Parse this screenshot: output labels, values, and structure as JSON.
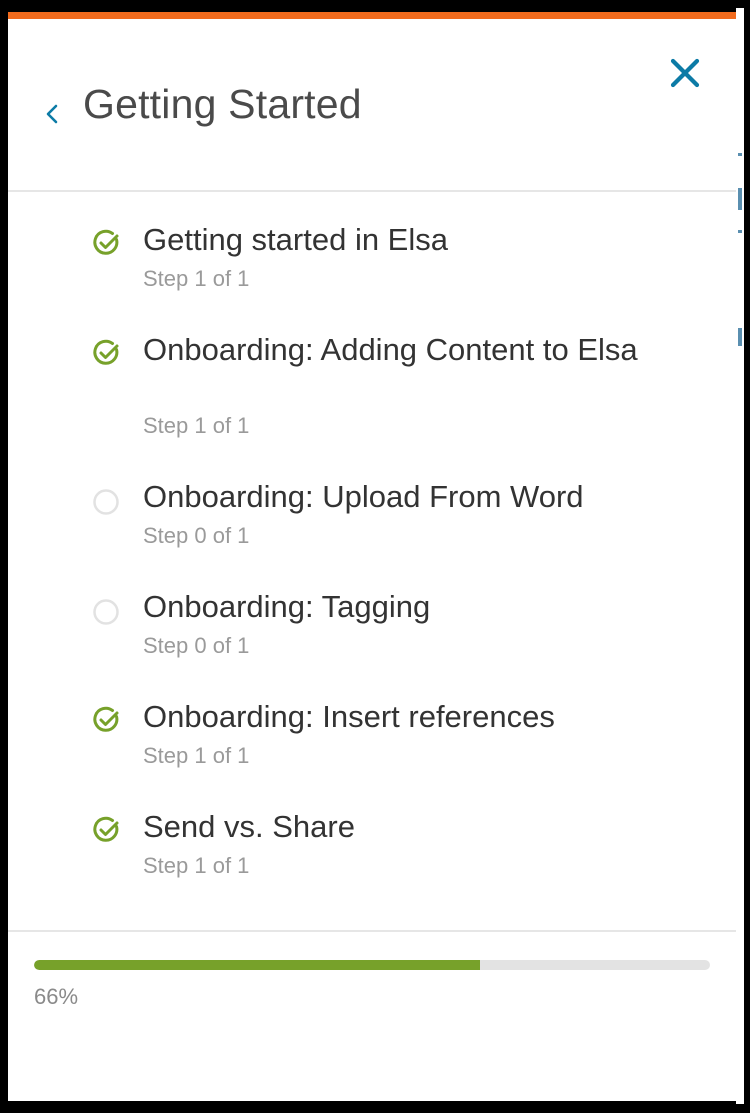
{
  "panel": {
    "title": "Getting Started",
    "accent_color": "#f26b1d",
    "back_icon": "chevron-left-icon",
    "close_icon": "close-icon"
  },
  "items": [
    {
      "title": "Getting started in Elsa",
      "step": "Step 1 of 1",
      "completed": true
    },
    {
      "title": "Onboarding: Adding Content to Elsa",
      "step": "Step 1 of 1",
      "completed": true
    },
    {
      "title": "Onboarding: Upload From Word",
      "step": "Step 0 of 1",
      "completed": false
    },
    {
      "title": "Onboarding: Tagging",
      "step": "Step 0 of 1",
      "completed": false
    },
    {
      "title": "Onboarding: Insert references",
      "step": "Step 1 of 1",
      "completed": true
    },
    {
      "title": "Send vs. Share",
      "step": "Step 1 of 1",
      "completed": true
    }
  ],
  "progress": {
    "percent": 66,
    "label": "66%",
    "fill_color": "#77a12a",
    "track_color": "#e3e3e3"
  },
  "colors": {
    "check_green": "#77a12a",
    "close_blue": "#0c7ba6",
    "pending_circle": "#e2e2e2"
  }
}
